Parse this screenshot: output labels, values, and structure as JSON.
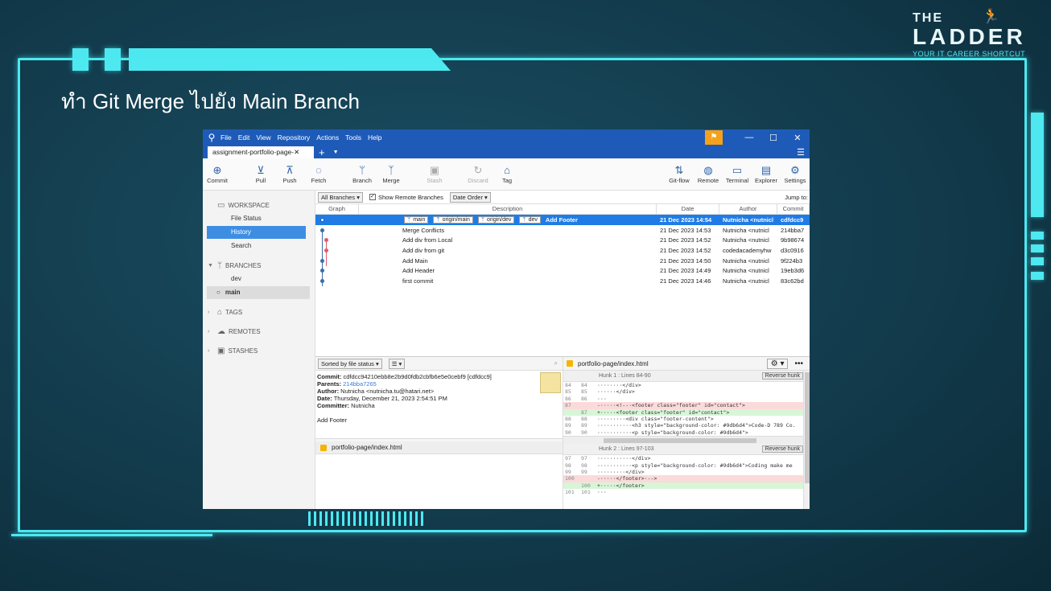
{
  "slide": {
    "title": "ทำ Git Merge ไปยัง Main Branch",
    "logo": {
      "the": "THE",
      "ladder": "LADDER",
      "tagline": "YOUR IT CAREER SHORTCUT"
    }
  },
  "app": {
    "menu": [
      "File",
      "Edit",
      "View",
      "Repository",
      "Actions",
      "Tools",
      "Help"
    ],
    "tab": {
      "label": "assignment-portfolio-page-",
      "close": "✕",
      "add": "+"
    },
    "toolbar": {
      "commit": "Commit",
      "pull": "Pull",
      "push": "Push",
      "fetch": "Fetch",
      "branch": "Branch",
      "merge": "Merge",
      "stash": "Stash",
      "discard": "Discard",
      "tag": "Tag",
      "gitflow": "Git-flow",
      "remote": "Remote",
      "terminal": "Terminal",
      "explorer": "Explorer",
      "settings": "Settings"
    },
    "sidebar": {
      "workspace": "WORKSPACE",
      "file_status": "File Status",
      "history": "History",
      "search": "Search",
      "branches": "BRANCHES",
      "dev": "dev",
      "main": "main",
      "tags": "TAGS",
      "remotes": "REMOTES",
      "stashes": "STASHES"
    },
    "filters": {
      "branches": "All Branches",
      "show_remote": "Show Remote Branches",
      "order": "Date Order",
      "jump": "Jump to:"
    },
    "columns": {
      "graph": "Graph",
      "description": "Description",
      "date": "Date",
      "author": "Author",
      "commit": "Commit"
    },
    "commits": [
      {
        "desc": "Add Footer",
        "date": "21 Dec 2023 14:54",
        "author": "Nutnicha <nutnicl",
        "hash": "cdfdcc9",
        "selected": true,
        "badges": [
          "main",
          "origin/main",
          "origin/dev",
          "dev"
        ]
      },
      {
        "desc": "Merge Conflicts",
        "date": "21 Dec 2023 14:53",
        "author": "Nutnicha <nutnicl",
        "hash": "214bba7"
      },
      {
        "desc": "Add div from Local",
        "date": "21 Dec 2023 14:52",
        "author": "Nutnicha <nutnicl",
        "hash": "9b98674"
      },
      {
        "desc": "Add div from git",
        "date": "21 Dec 2023 14:52",
        "author": "codedacademyhw",
        "hash": "d3c0916"
      },
      {
        "desc": "Add Main",
        "date": "21 Dec 2023 14:50",
        "author": "Nutnicha <nutnicl",
        "hash": "9f224b3"
      },
      {
        "desc": "Add Header",
        "date": "21 Dec 2023 14:49",
        "author": "Nutnicha <nutnicl",
        "hash": "19eb3d6"
      },
      {
        "desc": "first commit",
        "date": "21 Dec 2023 14:46",
        "author": "Nutnicha <nutnicl",
        "hash": "83c62bd"
      }
    ],
    "details": {
      "sort": "Sorted by file status",
      "commit_label": "Commit:",
      "commit_value": "cdfdcc94210ebb8e2b9d0fdb2cbfb6e5e0cebf9 [cdfdcc9]",
      "parents_label": "Parents:",
      "parents_value": "214bba7265",
      "author_label": "Author:",
      "author_value": "Nutnicha <nutnicha.tu@hatari.net>",
      "date_label": "Date:",
      "date_value": "Thursday, December 21, 2023 2:54:51 PM",
      "committer_label": "Committer:",
      "committer_value": "Nutnicha",
      "message": "Add Footer",
      "file": "portfolio-page/index.html"
    },
    "diff": {
      "file": "portfolio-page/index.html",
      "hunk1": "Hunk 1 : Lines 84-90",
      "hunk2": "Hunk 2 : Lines 97-103",
      "reverse": "Reverse hunk",
      "hunk1_lines": [
        {
          "n1": "84",
          "n2": "84",
          "type": "ctx",
          "code": "········</div>"
        },
        {
          "n1": "85",
          "n2": "85",
          "type": "ctx",
          "code": "······</div>"
        },
        {
          "n1": "86",
          "n2": "86",
          "type": "ctx",
          "code": "···"
        },
        {
          "n1": "87",
          "n2": "",
          "type": "del",
          "code": "-·····<!--·<footer class=\"footer\" id=\"contact\">"
        },
        {
          "n1": "",
          "n2": "87",
          "type": "add",
          "code": "+·····<footer class=\"footer\" id=\"contact\">"
        },
        {
          "n1": "88",
          "n2": "88",
          "type": "ctx",
          "code": "·········<div class=\"footer-content\">"
        },
        {
          "n1": "89",
          "n2": "89",
          "type": "ctx",
          "code": "···········<h3 style=\"background-color: #9db6d4\">Code-D 789 Co."
        },
        {
          "n1": "90",
          "n2": "90",
          "type": "ctx",
          "code": "···········<p style=\"background-color: #9db6d4\">"
        }
      ],
      "hunk2_lines": [
        {
          "n1": "97",
          "n2": "97",
          "type": "ctx",
          "code": "···········</div>"
        },
        {
          "n1": "98",
          "n2": "98",
          "type": "ctx",
          "code": "···········<p style=\"background-color: #9db6d4\">Coding make me"
        },
        {
          "n1": "99",
          "n2": "99",
          "type": "ctx",
          "code": "·········</div>"
        },
        {
          "n1": "100",
          "n2": "",
          "type": "del",
          "code": "-·····</footer>·-->"
        },
        {
          "n1": "",
          "n2": "100",
          "type": "add",
          "code": "+·····</footer>"
        },
        {
          "n1": "101",
          "n2": "101",
          "type": "ctx",
          "code": "···"
        }
      ]
    }
  }
}
